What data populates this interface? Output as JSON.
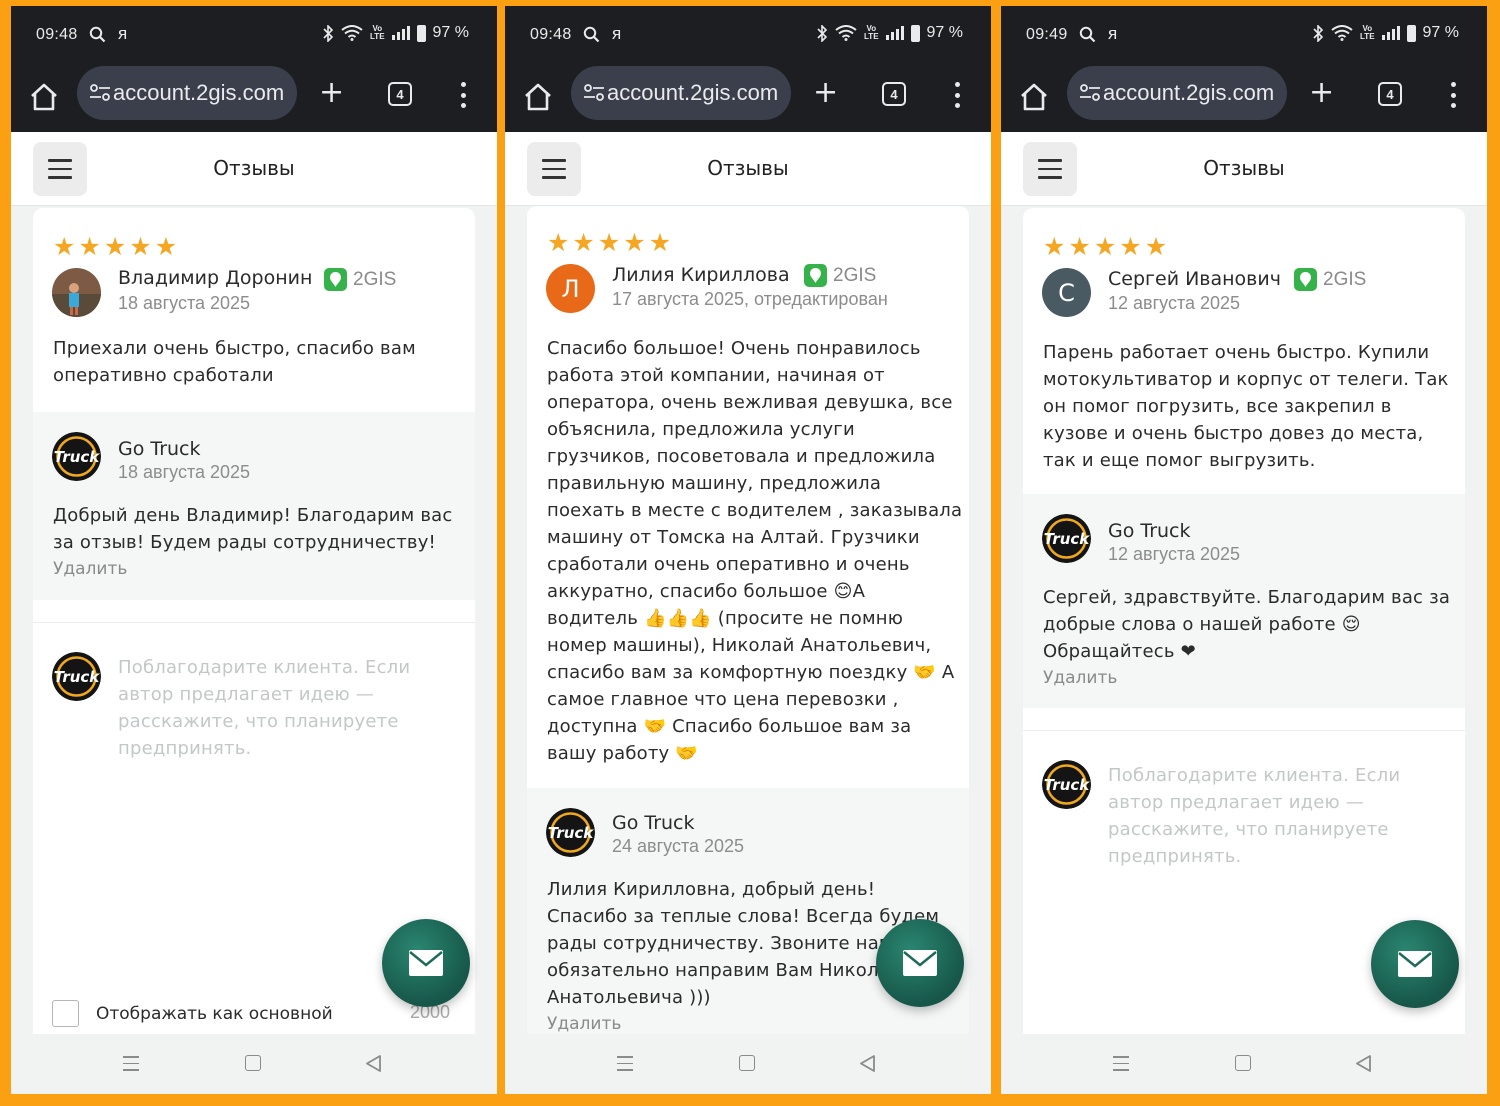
{
  "screens": [
    {
      "status": {
        "time": "09:48",
        "app_letter": "я",
        "battery": "97 %",
        "volte": "Vo LTE"
      },
      "browser": {
        "url": "account.2gis.com",
        "tab_count": "4"
      },
      "header": {
        "title": "Отзывы"
      },
      "review": {
        "rating": 5,
        "author": "Владимир Доронин",
        "avatar_letter": "",
        "source": "2GIS",
        "date": "18 августа 2025",
        "lines": [
          "Приехали очень быстро, спасибо вам",
          "оперативно сработали"
        ]
      },
      "reply": {
        "author": "Go Truck",
        "date": "18 августа 2025",
        "lines": [
          "Добрый день Владимир! Благодарим вас",
          "за отзыв! Будем рады сотрудничеству!"
        ],
        "delete_label": "Удалить"
      },
      "compose": {
        "placeholder_lines": [
          "Поблагодарите клиента. Если",
          "автор предлагает идею —",
          "расскажите, что планируете",
          "предпринять."
        ],
        "checkbox_label": "Отображать как основной",
        "counter": "2000"
      }
    },
    {
      "status": {
        "time": "09:48",
        "app_letter": "я",
        "battery": "97 %",
        "volte": "Vo LTE"
      },
      "browser": {
        "url": "account.2gis.com",
        "tab_count": "4"
      },
      "header": {
        "title": "Отзывы"
      },
      "review": {
        "rating": 5,
        "author": "Лилия Кириллова",
        "avatar_letter": "Л",
        "source": "2GIS",
        "date": "17 августа 2025, отредактирован",
        "lines": [
          "Спасибо большое! Очень понравилось",
          "работа этой компании, начиная от",
          "оператора, очень вежливая девушка, все",
          "объяснила, предложила услуги",
          "грузчиков, посоветовала и предложила",
          "правильную машину, предложила",
          "поехать в месте с водителем , заказывала",
          "машину от Томска на Алтай. Грузчики",
          "сработали очень оперативно и очень",
          "аккуратно, спасибо большое 😊А",
          "водитель 👍👍👍 (просите не помню",
          "номер машины), Николай Анатольевич,",
          "спасибо вам за комфортную поездку 🤝 А",
          "самое главное что цена перевозки ,",
          "доступна 🤝 Спасибо большое вам за",
          "вашу работу 🤝"
        ]
      },
      "reply": {
        "author": "Go Truck",
        "date": "24 августа 2025",
        "lines": [
          "Лилия Кирилловна, добрый день!",
          "Спасибо за теплые слова! Всегда будем",
          "рады сотрудничеству. Звоните нам",
          "обязательно направим Вам Никола",
          "Анатольевича )))"
        ],
        "delete_label": "Удалить"
      }
    },
    {
      "status": {
        "time": "09:49",
        "app_letter": "я",
        "battery": "97 %",
        "volte": "Vo LTE"
      },
      "browser": {
        "url": "account.2gis.com",
        "tab_count": "4"
      },
      "header": {
        "title": "Отзывы"
      },
      "review": {
        "rating": 5,
        "author": "Сергей Иванович",
        "avatar_letter": "С",
        "source": "2GIS",
        "date": "12 августа 2025",
        "lines": [
          "Парень работает очень быстро. Купили",
          "мотокультиватор и корпус от телеги. Так",
          "он помог погрузить, все закрепил в",
          "кузове и очень быстро довез до места,",
          "так и еще помог выгрузить."
        ]
      },
      "reply": {
        "author": "Go Truck",
        "date": "12 августа 2025",
        "lines": [
          "Сергей, здравствуйте. Благодарим вас за",
          "добрые слова о нашей работе 😌",
          "Обращайтесь ❤"
        ],
        "delete_label": "Удалить"
      },
      "compose": {
        "placeholder_lines": [
          "Поблагодарите клиента. Если",
          "автор предлагает идею —",
          "расскажите, что планируете",
          "предпринять."
        ]
      }
    }
  ],
  "colors": {
    "star": "#f5a623",
    "badge_2gis": "#36b24a",
    "fab": "#1e6b5a",
    "frame": "#fba012",
    "avatar_l": "#e86a18",
    "avatar_s": "#4a5a62"
  },
  "icons": [
    "search-icon",
    "bluetooth-icon",
    "wifi-icon",
    "signal-icon",
    "battery-icon",
    "home-icon",
    "site-settings-icon",
    "plus-icon",
    "tabs-icon",
    "more-icon",
    "menu-icon",
    "star-icon",
    "2gis-icon",
    "mail-icon",
    "recents-icon",
    "back-icon"
  ]
}
